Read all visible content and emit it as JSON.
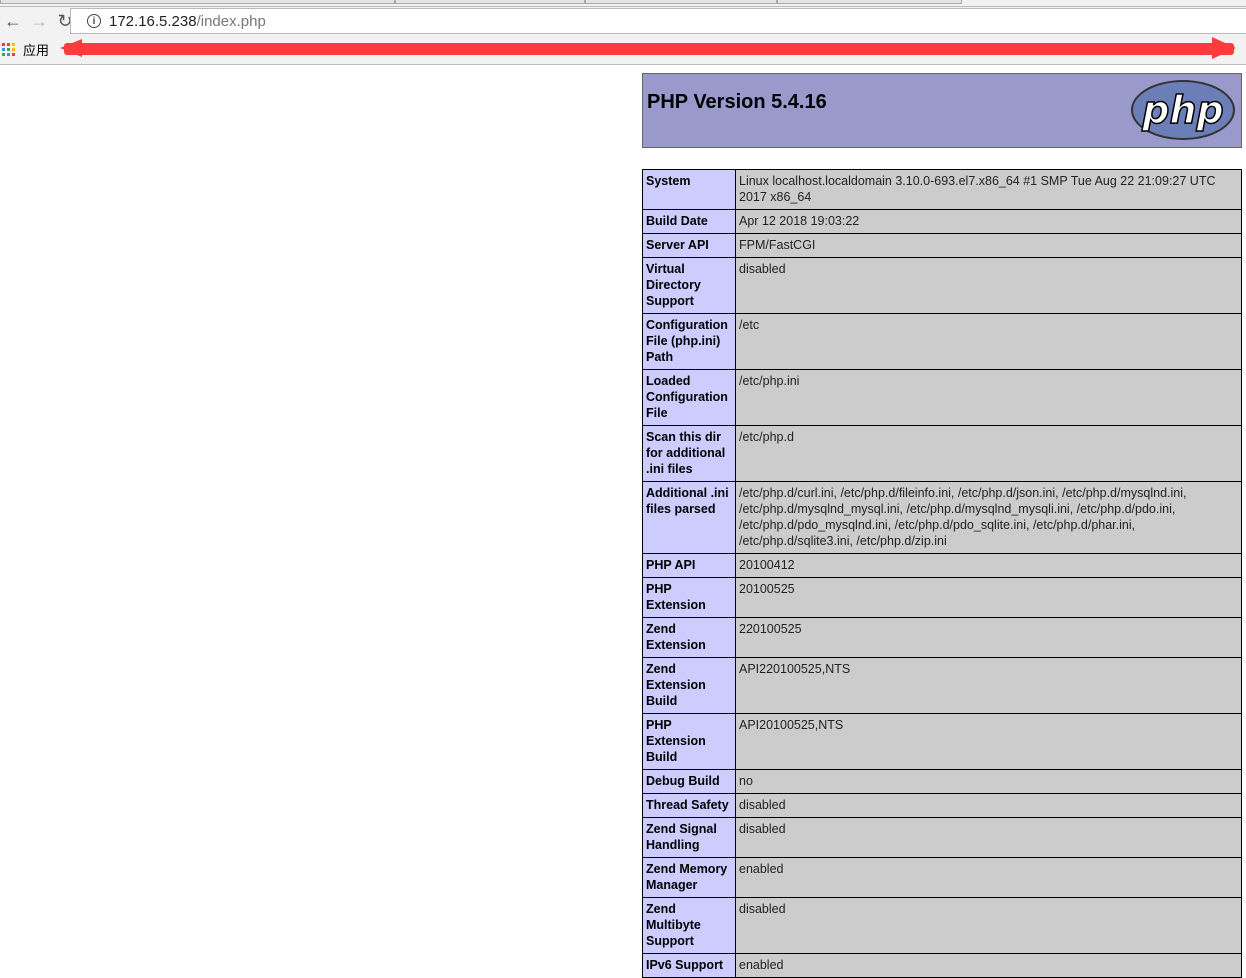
{
  "browser": {
    "url_host": "172.16.5.238",
    "url_path": "/index.php",
    "bookmarks_apps_label": "应用"
  },
  "header": {
    "title": "PHP Version 5.4.16",
    "logo_text": "php"
  },
  "rows": [
    {
      "k": "System",
      "v": "Linux localhost.localdomain 3.10.0-693.el7.x86_64 #1 SMP Tue Aug 22 21:09:27 UTC 2017 x86_64"
    },
    {
      "k": "Build Date",
      "v": "Apr 12 2018 19:03:22"
    },
    {
      "k": "Server API",
      "v": "FPM/FastCGI"
    },
    {
      "k": "Virtual Directory Support",
      "v": "disabled"
    },
    {
      "k": "Configuration File (php.ini) Path",
      "v": "/etc"
    },
    {
      "k": "Loaded Configuration File",
      "v": "/etc/php.ini"
    },
    {
      "k": "Scan this dir for additional .ini files",
      "v": "/etc/php.d"
    },
    {
      "k": "Additional .ini files parsed",
      "v": "/etc/php.d/curl.ini, /etc/php.d/fileinfo.ini, /etc/php.d/json.ini, /etc/php.d/mysqlnd.ini, /etc/php.d/mysqlnd_mysql.ini, /etc/php.d/mysqlnd_mysqli.ini, /etc/php.d/pdo.ini, /etc/php.d/pdo_mysqlnd.ini, /etc/php.d/pdo_sqlite.ini, /etc/php.d/phar.ini, /etc/php.d/sqlite3.ini, /etc/php.d/zip.ini"
    },
    {
      "k": "PHP API",
      "v": "20100412"
    },
    {
      "k": "PHP Extension",
      "v": "20100525"
    },
    {
      "k": "Zend Extension",
      "v": "220100525"
    },
    {
      "k": "Zend Extension Build",
      "v": "API220100525,NTS"
    },
    {
      "k": "PHP Extension Build",
      "v": "API20100525,NTS"
    },
    {
      "k": "Debug Build",
      "v": "no"
    },
    {
      "k": "Thread Safety",
      "v": "disabled"
    },
    {
      "k": "Zend Signal Handling",
      "v": "disabled"
    },
    {
      "k": "Zend Memory Manager",
      "v": "enabled"
    },
    {
      "k": "Zend Multibyte Support",
      "v": "disabled"
    },
    {
      "k": "IPv6 Support",
      "v": "enabled"
    }
  ]
}
